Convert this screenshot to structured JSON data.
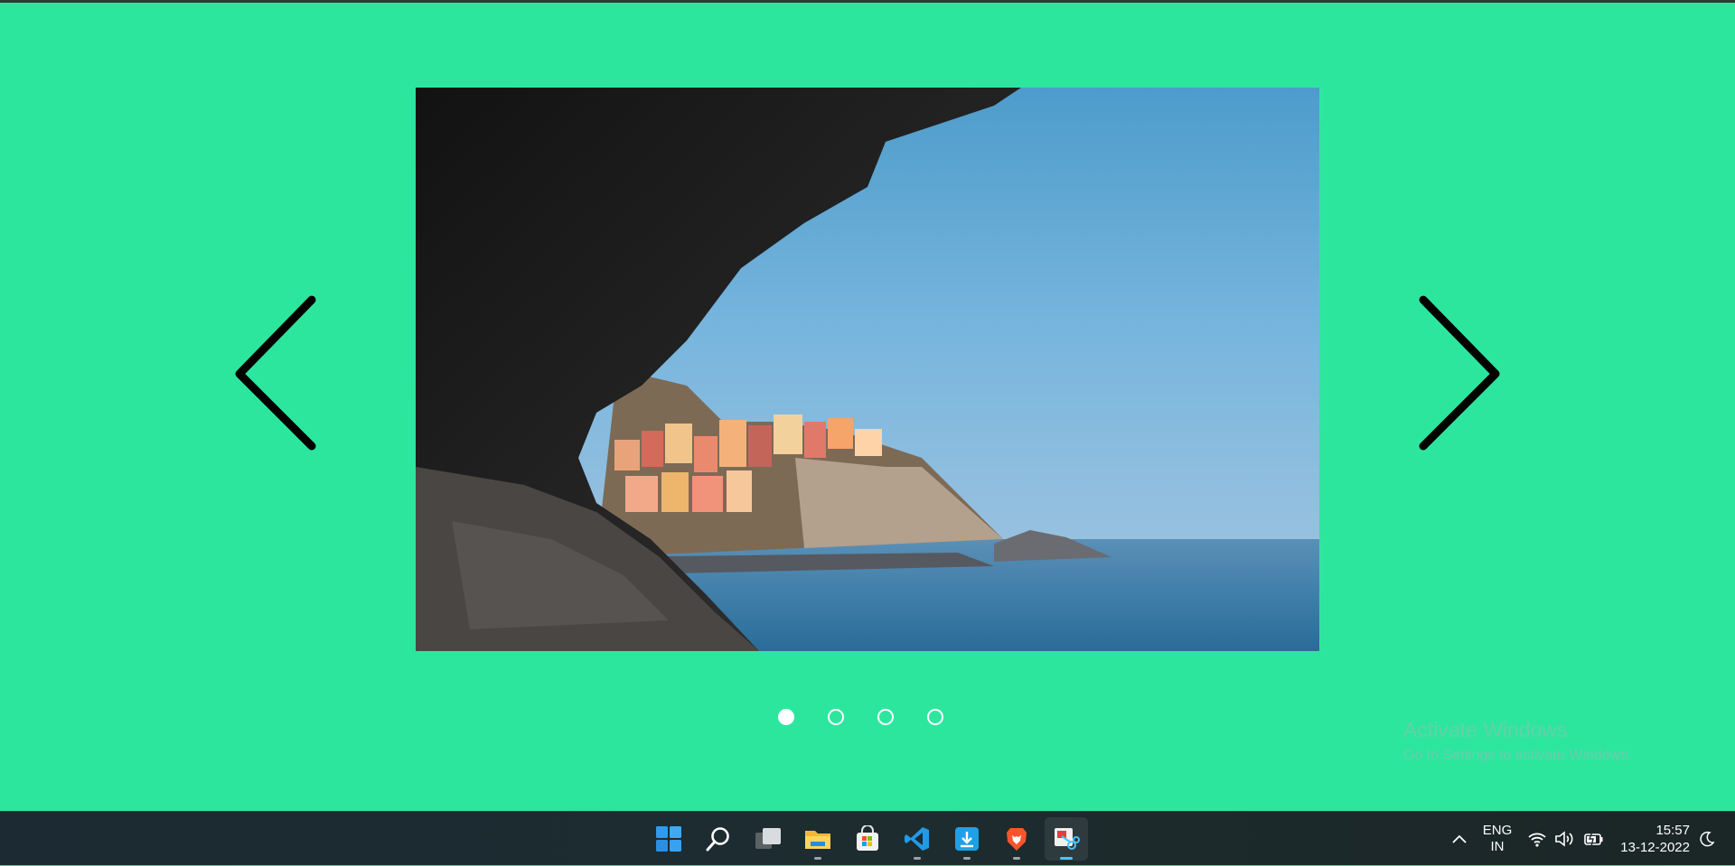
{
  "carousel": {
    "slide_image": "coastal village cliff viewed from sea cave",
    "prev_icon": "chevron-left-icon",
    "next_icon": "chevron-right-icon",
    "dots": [
      {
        "active": true
      },
      {
        "active": false
      },
      {
        "active": false
      },
      {
        "active": false
      }
    ]
  },
  "watermark": {
    "line1": "Activate Windows",
    "line2": "Go to Settings to activate Windows."
  },
  "taskbar": {
    "apps": [
      {
        "name": "start",
        "icon": "windows-logo-icon"
      },
      {
        "name": "search",
        "icon": "search-icon"
      },
      {
        "name": "task-view",
        "icon": "task-view-icon"
      },
      {
        "name": "file-explorer",
        "icon": "folder-icon"
      },
      {
        "name": "microsoft-store",
        "icon": "store-icon"
      },
      {
        "name": "vs-code",
        "icon": "vscode-icon"
      },
      {
        "name": "download-app",
        "icon": "download-box-icon"
      },
      {
        "name": "brave",
        "icon": "brave-lion-icon"
      },
      {
        "name": "snipping-tool",
        "icon": "snipping-tool-icon"
      }
    ],
    "tray": {
      "lang_line1": "ENG",
      "lang_line2": "IN",
      "time": "15:57",
      "date": "13-12-2022"
    }
  },
  "colors": {
    "background": "#2de69e",
    "arrow": "#000000",
    "dot": "#ffffff",
    "taskbar": "#1c2a2e",
    "active_indicator": "#4cc2ff"
  }
}
